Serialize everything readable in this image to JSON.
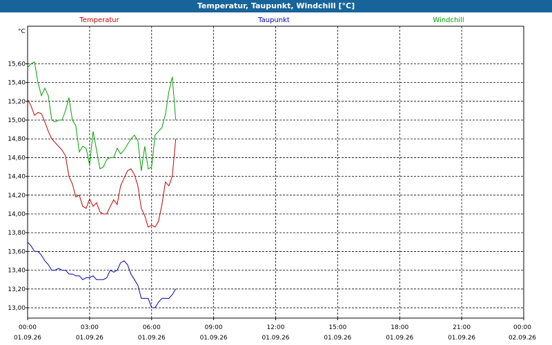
{
  "window": {
    "title": "Temperatur, Taupunkt, Windchill [°C]"
  },
  "colors": {
    "titlebar": "#17649a",
    "temperatur": "#c00000",
    "taupunkt": "#0000b0",
    "windchill": "#00a000"
  },
  "chart_data": {
    "type": "line",
    "ylabel": "°C",
    "ylim": [
      12.89,
      16.0
    ],
    "xlim": [
      "01.09.26 00:00",
      "02.09.26 00:00"
    ],
    "grid": true,
    "legend_placement": "top",
    "y_ticks": [
      "13,00",
      "13,20",
      "13,40",
      "13,60",
      "13,80",
      "14,00",
      "14,20",
      "14,40",
      "14,60",
      "14,80",
      "15,00",
      "15,20",
      "15,40",
      "15,60"
    ],
    "x_ticks": [
      {
        "time": "00:00",
        "date": "01.09.26"
      },
      {
        "time": "03:00",
        "date": "01.09.26"
      },
      {
        "time": "06:00",
        "date": "01.09.26"
      },
      {
        "time": "09:00",
        "date": "01.09.26"
      },
      {
        "time": "12:00",
        "date": "01.09.26"
      },
      {
        "time": "15:00",
        "date": "01.09.26"
      },
      {
        "time": "18:00",
        "date": "01.09.26"
      },
      {
        "time": "21:00",
        "date": "01.09.26"
      },
      {
        "time": "00:00",
        "date": "02.09.26"
      }
    ],
    "x": [
      "00:00",
      "00:10",
      "00:20",
      "00:30",
      "00:40",
      "00:50",
      "01:00",
      "01:10",
      "01:20",
      "01:30",
      "01:40",
      "01:50",
      "02:00",
      "02:10",
      "02:20",
      "02:30",
      "02:40",
      "02:50",
      "03:00",
      "03:10",
      "03:20",
      "03:30",
      "03:40",
      "03:50",
      "04:00",
      "04:10",
      "04:20",
      "04:30",
      "04:40",
      "04:50",
      "05:00",
      "05:10",
      "05:20",
      "05:30",
      "05:40",
      "05:50",
      "06:00",
      "06:10",
      "06:20",
      "06:30",
      "06:40",
      "06:50",
      "07:00",
      "07:10"
    ],
    "series": [
      {
        "name": "Temperatur",
        "color": "#c00000",
        "values": [
          15.22,
          15.15,
          15.05,
          15.08,
          15.07,
          14.98,
          14.88,
          14.8,
          14.76,
          14.72,
          14.68,
          14.62,
          14.4,
          14.32,
          14.18,
          14.2,
          14.08,
          14.06,
          14.16,
          14.08,
          14.12,
          14.02,
          14.0,
          14.0,
          14.08,
          14.15,
          14.1,
          14.3,
          14.38,
          14.46,
          14.48,
          14.42,
          14.3,
          14.06,
          13.98,
          13.86,
          13.88,
          13.86,
          13.92,
          14.1,
          14.34,
          14.3,
          14.4,
          14.8
        ]
      },
      {
        "name": "Taupunkt",
        "color": "#0000b0",
        "values": [
          13.7,
          13.66,
          13.6,
          13.6,
          13.56,
          13.5,
          13.46,
          13.4,
          13.4,
          13.42,
          13.4,
          13.4,
          13.36,
          13.36,
          13.34,
          13.34,
          13.3,
          13.32,
          13.32,
          13.34,
          13.3,
          13.3,
          13.3,
          13.32,
          13.4,
          13.38,
          13.4,
          13.48,
          13.5,
          13.46,
          13.36,
          13.3,
          13.24,
          13.1,
          13.1,
          13.1,
          13.0,
          13.0,
          13.06,
          13.1,
          13.1,
          13.1,
          13.14,
          13.2
        ]
      },
      {
        "name": "Windchill",
        "color": "#00a000",
        "values": [
          15.56,
          15.6,
          15.62,
          15.4,
          15.26,
          15.34,
          15.26,
          15.0,
          14.98,
          15.0,
          15.0,
          15.1,
          15.24,
          15.0,
          14.94,
          14.66,
          14.72,
          14.7,
          14.52,
          14.88,
          14.68,
          14.48,
          14.5,
          14.58,
          14.6,
          14.6,
          14.7,
          14.64,
          14.68,
          14.74,
          14.8,
          14.84,
          14.78,
          14.46,
          14.72,
          14.48,
          14.5,
          14.84,
          14.88,
          14.92,
          15.06,
          15.3,
          15.46,
          15.0
        ]
      }
    ]
  }
}
